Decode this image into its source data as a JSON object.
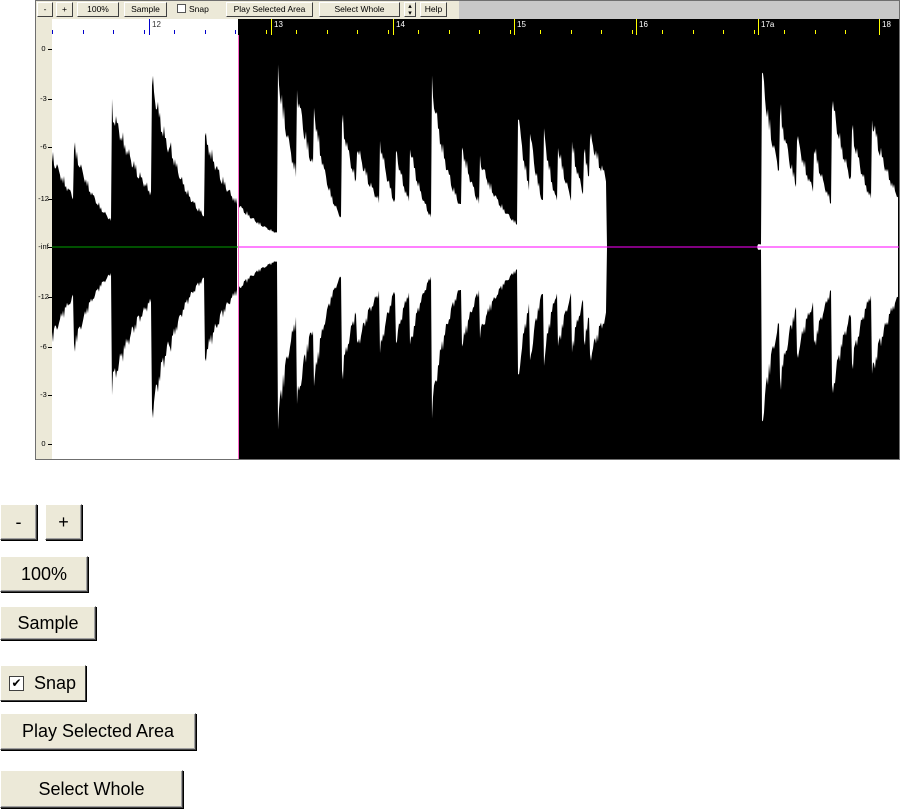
{
  "toolbar": {
    "zoom_out": "-",
    "zoom_in": "+",
    "zoom_100": "100%",
    "sample": "Sample",
    "snap": "Snap",
    "play_selected": "Play Selected Area",
    "select_whole": "Select Whole",
    "help": "Help"
  },
  "ruler": {
    "bars": [
      "12",
      "13",
      "14",
      "15",
      "16",
      "17a",
      "18"
    ]
  },
  "db_scale": [
    "0",
    "-3",
    "-6",
    "-12",
    "-inf",
    "-12",
    "-6",
    "-3",
    "0"
  ],
  "big_buttons": {
    "minus": "-",
    "plus": "+",
    "zoom_100": "100%",
    "sample": "Sample",
    "snap": "Snap",
    "snap_checked": true,
    "play_selected": "Play Selected Area",
    "select_whole": "Select Whole"
  },
  "colors": {
    "selection_bg": "#ffffff",
    "waveform_bg": "#000000",
    "center_line_selected": "#00a000",
    "center_line": "#ff00ff",
    "selection_edge": "#ff66cc",
    "ruler_marks_selected": "#0000cc",
    "ruler_marks": "#ffff00"
  }
}
